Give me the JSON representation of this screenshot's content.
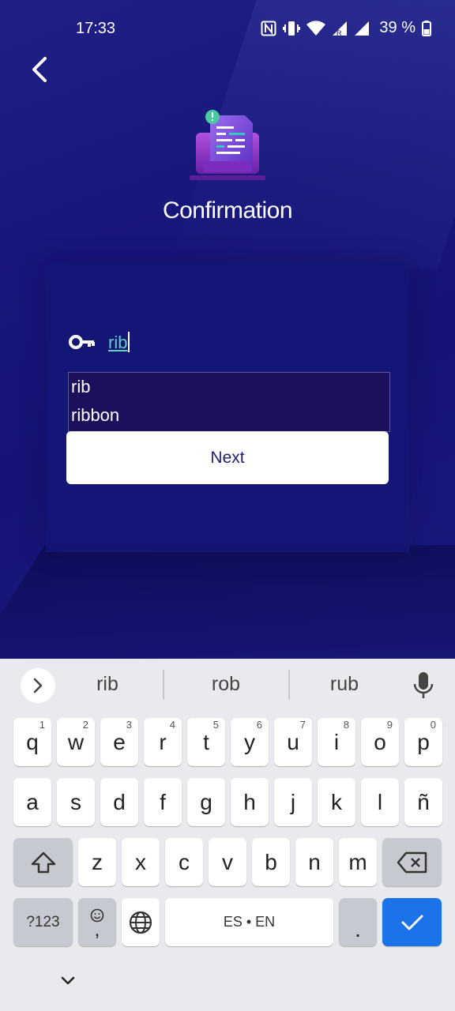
{
  "status_bar": {
    "time": "17:33",
    "battery": "39 %",
    "icons": [
      "nfc-icon",
      "vibrate-icon",
      "wifi-icon",
      "signal-roaming-icon",
      "signal-icon",
      "battery-icon"
    ]
  },
  "screen": {
    "title": "Confirmation",
    "back_icon": "chevron-left-icon",
    "hero_icon": "document-printer-alert-icon",
    "key_icon": "key-icon",
    "input_value": "rib",
    "autocomplete": [
      "rib",
      "ribbon"
    ],
    "next_label": "Next"
  },
  "colors": {
    "background": "#17167a",
    "accent_teal": "#5fcfc0",
    "button_text": "#1f1f6e",
    "keyboard_enter": "#1a73e8"
  },
  "keyboard": {
    "suggestions": [
      "rib",
      "rob",
      "rub"
    ],
    "row1": [
      {
        "label": "q",
        "num": "1"
      },
      {
        "label": "w",
        "num": "2"
      },
      {
        "label": "e",
        "num": "3"
      },
      {
        "label": "r",
        "num": "4"
      },
      {
        "label": "t",
        "num": "5"
      },
      {
        "label": "y",
        "num": "6"
      },
      {
        "label": "u",
        "num": "7"
      },
      {
        "label": "i",
        "num": "8"
      },
      {
        "label": "o",
        "num": "9"
      },
      {
        "label": "p",
        "num": "0"
      }
    ],
    "row2": [
      "a",
      "s",
      "d",
      "f",
      "g",
      "h",
      "j",
      "k",
      "l",
      "ñ"
    ],
    "row3": [
      "z",
      "x",
      "c",
      "v",
      "b",
      "n",
      "m"
    ],
    "symbols_label": "?123",
    "comma_label": ",",
    "space_label": "ES • EN",
    "period_label": "."
  }
}
